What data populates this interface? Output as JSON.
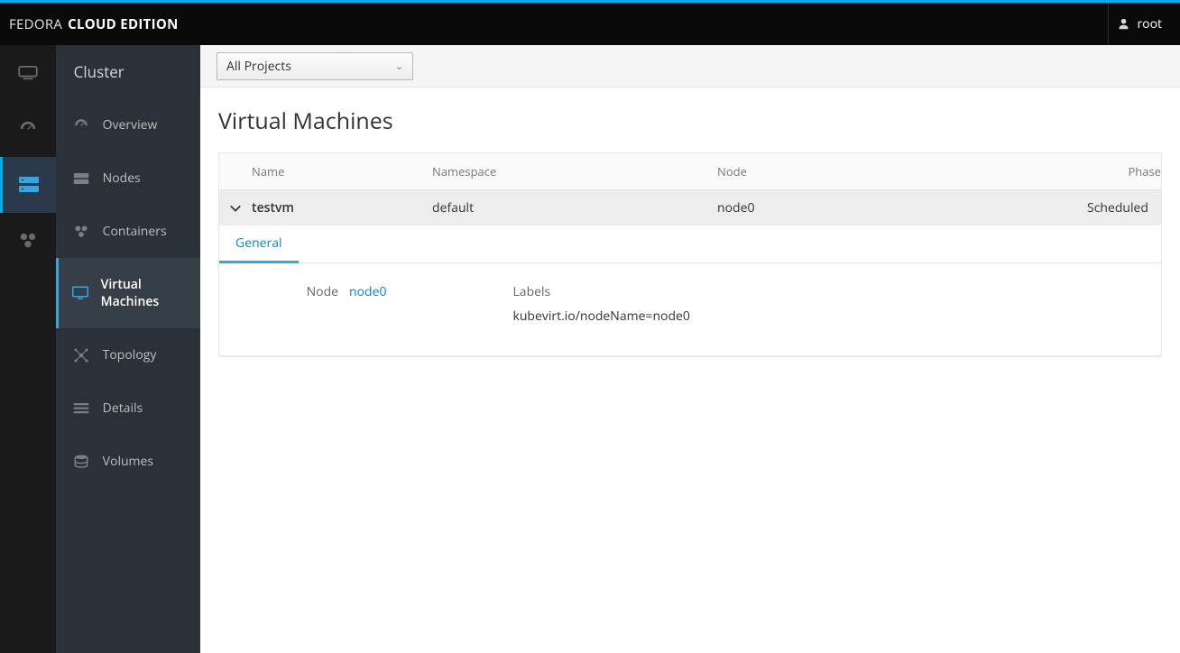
{
  "brand": {
    "thin": "FEDORA",
    "bold": "CLOUD EDITION"
  },
  "user": {
    "name": "root"
  },
  "sidebar": {
    "title": "Cluster",
    "items": [
      {
        "label": "Overview"
      },
      {
        "label": "Nodes"
      },
      {
        "label": "Containers"
      },
      {
        "label": "Virtual Machines"
      },
      {
        "label": "Topology"
      },
      {
        "label": "Details"
      },
      {
        "label": "Volumes"
      }
    ]
  },
  "projectbar": {
    "selected": "All Projects"
  },
  "page": {
    "title": "Virtual Machines"
  },
  "table": {
    "columns": {
      "name": "Name",
      "namespace": "Namespace",
      "node": "Node",
      "phase": "Phase"
    },
    "rows": [
      {
        "name": "testvm",
        "namespace": "default",
        "node": "node0",
        "phase": "Scheduled"
      }
    ]
  },
  "tabs": [
    {
      "label": "General"
    }
  ],
  "detail": {
    "node_label": "Node",
    "node_value": "node0",
    "labels_label": "Labels",
    "labels_value": "kubevirt.io/nodeName=node0"
  }
}
